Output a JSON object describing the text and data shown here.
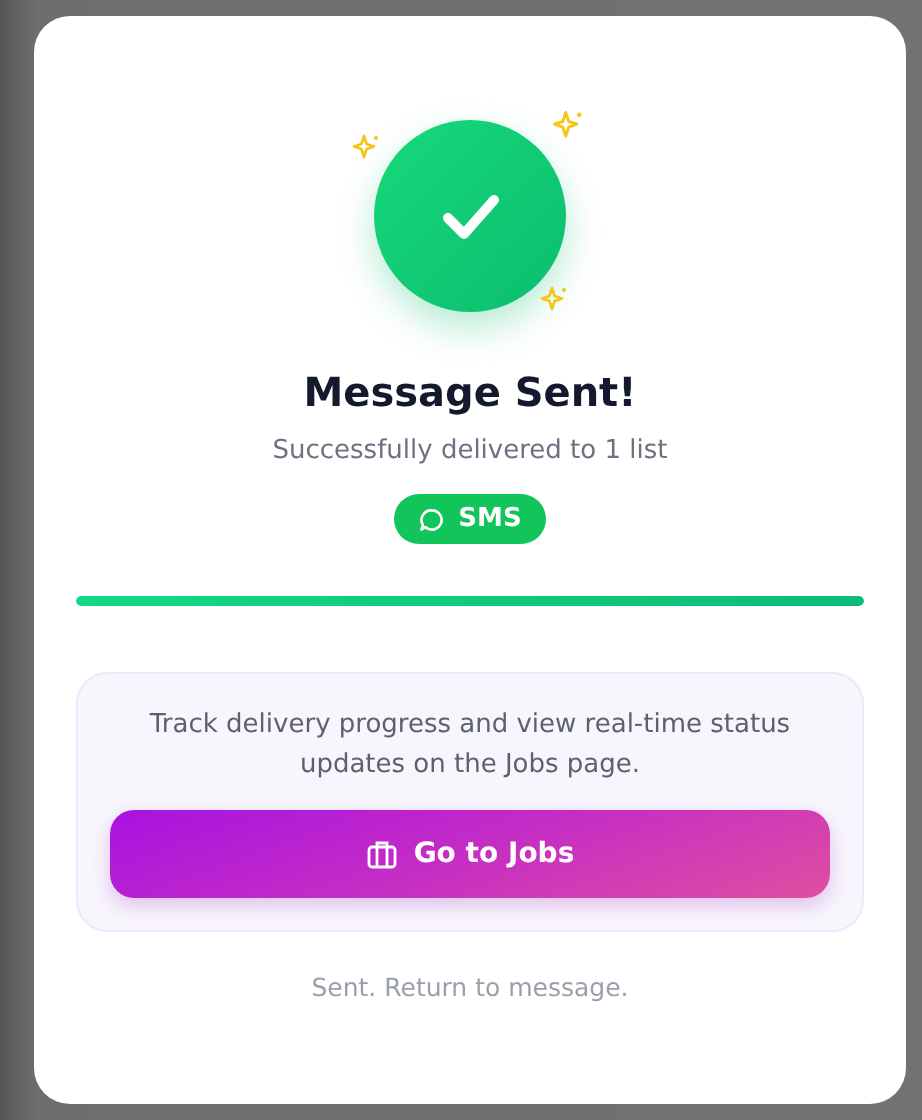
{
  "dialog": {
    "title": "Message Sent!",
    "subtitle": "Successfully delivered to 1 list"
  },
  "channel": {
    "label": "SMS"
  },
  "progress": {
    "level": 1
  },
  "info": {
    "text": "Track delivery progress and view real-time status updates on the Jobs page.",
    "button": {
      "label": "Go to Jobs"
    }
  },
  "footer": {
    "text": "Sent. Return to message."
  }
}
